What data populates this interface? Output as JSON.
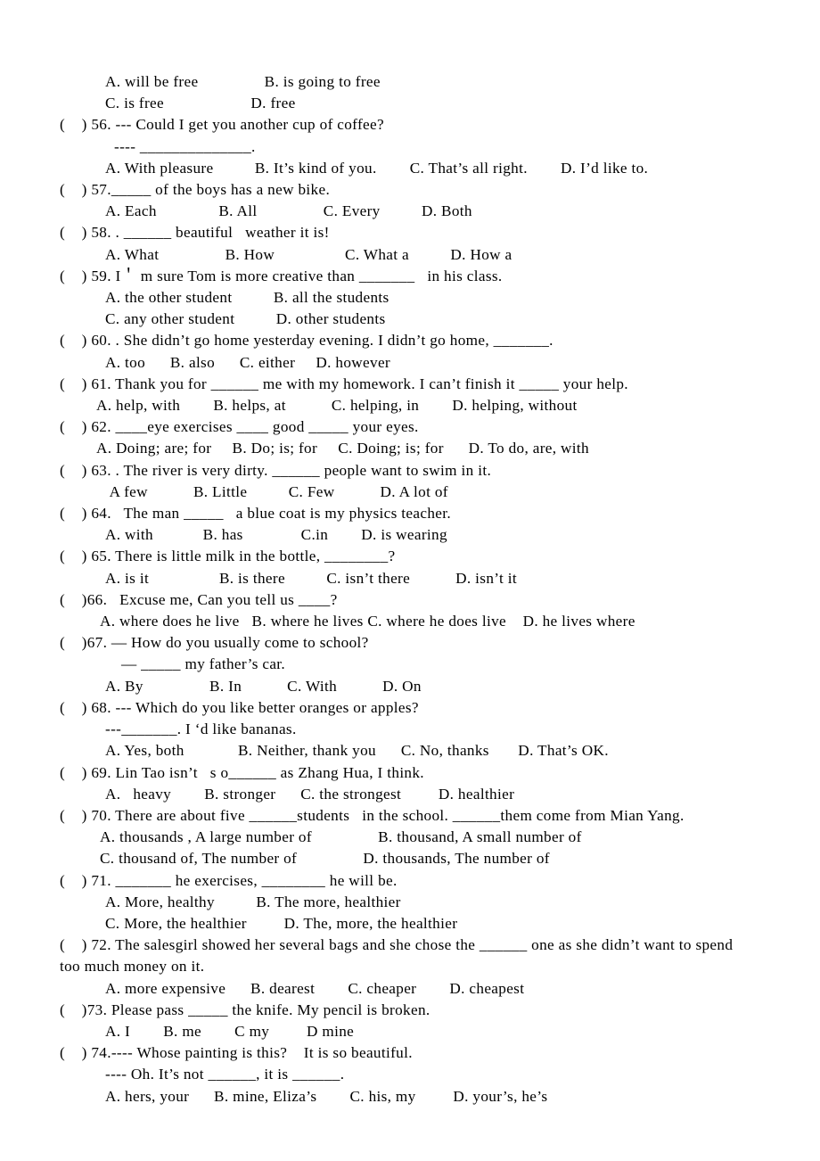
{
  "document": {
    "type": "multiple-choice-grammar-worksheet",
    "page_background": "#ffffff",
    "text_color": "#000000"
  },
  "carryover_options": {
    "row1": "A. will be free                B. is going to free",
    "row2": "C. is free                     D. free"
  },
  "questions": [
    {
      "number": "56",
      "stem": "(    ) 56. --- Could I get you another cup of coffee?",
      "sub": "---- ______________.",
      "option_rows": [
        "A. With pleasure          B. It’s kind of you.        C. That’s all right.        D. I’d like to."
      ]
    },
    {
      "number": "57",
      "stem": "(    ) 57._____ of the boys has a new bike.",
      "option_rows": [
        "A. Each               B. All                C. Every          D. Both"
      ]
    },
    {
      "number": "58",
      "stem": "(    ) 58. . ______ beautiful   weather it is!",
      "option_rows": [
        "A. What                B. How                 C. What a          D. How a"
      ]
    },
    {
      "number": "59",
      "stem": "(    ) 59. I＇ m sure Tom is more creative than _______   in his class.",
      "option_rows": [
        "A. the other student          B. all the students",
        "C. any other student          D. other students"
      ]
    },
    {
      "number": "60",
      "stem": "(    ) 60. . She didn’t go home yesterday evening. I didn’t go home, _______.",
      "option_rows": [
        "A. too      B. also      C. either     D. however"
      ]
    },
    {
      "number": "61",
      "stem": "(    ) 61. Thank you for ______ me with my homework. I can’t finish it _____ your help.",
      "option_rows": [
        "A. help, with        B. helps, at           C. helping, in        D. helping, without"
      ]
    },
    {
      "number": "62",
      "stem": "(    ) 62. ____eye exercises ____ good _____ your eyes.",
      "option_rows": [
        "A. Doing; are; for     B. Do; is; for     C. Doing; is; for      D. To do, are, with"
      ]
    },
    {
      "number": "63",
      "stem": "(    ) 63. . The river is very dirty. ______ people want to swim in it.",
      "option_rows": [
        " A few           B. Little          C. Few           D. A lot of"
      ]
    },
    {
      "number": "64",
      "stem": "(    ) 64.   The man _____   a blue coat is my physics teacher.",
      "option_rows": [
        "A. with            B. has              C.in        D. is wearing"
      ]
    },
    {
      "number": "65",
      "stem": "(    ) 65. There is little milk in the bottle, ________?",
      "option_rows": [
        "A. is it                 B. is there          C. isn’t there           D. isn’t it"
      ]
    },
    {
      "number": "66",
      "stem": "(    )66.   Excuse me, Can you tell us ____?",
      "option_rows": [
        "A. where does he live   B. where he lives C. where he does live    D. he lives where"
      ]
    },
    {
      "number": "67",
      "stem": "(    )67. — How do you usually come to school?",
      "sub": "— _____ my father’s car.",
      "option_rows": [
        "A. By                B. In           C. With           D. On"
      ]
    },
    {
      "number": "68",
      "stem": "(    ) 68. --- Which do you like better oranges or apples?",
      "sub": "---_______. I ‘d like bananas.",
      "option_rows": [
        "A. Yes, both             B. Neither, thank you      C. No, thanks       D. That’s OK."
      ]
    },
    {
      "number": "69",
      "stem": "(    ) 69. Lin Tao isn’t   s o______ as Zhang Hua, I think.",
      "option_rows": [
        "A.   heavy        B. stronger      C. the strongest         D. healthier"
      ]
    },
    {
      "number": "70",
      "stem": "(    ) 70. There are about five ______students   in the school. ______them come from Mian Yang.",
      "option_rows": [
        "A. thousands , A large number of                B. thousand, A small number of",
        "C. thousand of, The number of                D. thousands, The number of"
      ]
    },
    {
      "number": "71",
      "stem": "(    ) 71. _______ he exercises, ________ he will be.",
      "option_rows": [
        "A. More, healthy          B. The more, healthier",
        "C. More, the healthier         D. The, more, the healthier"
      ]
    },
    {
      "number": "72",
      "stem": "(    ) 72. The salesgirl showed her several bags and she chose the ______ one as she didn’t want to spend",
      "stem_wrap": "too much money on it.",
      "option_rows": [
        "A. more expensive      B. dearest        C. cheaper        D. cheapest"
      ]
    },
    {
      "number": "73",
      "stem": "(    )73. Please pass _____ the knife. My pencil is broken.",
      "option_rows": [
        "A. I        B. me        C my         D mine"
      ]
    },
    {
      "number": "74",
      "stem": "(    ) 74.---- Whose painting is this?    It is so beautiful.",
      "sub": "---- Oh. It’s not ______, it is ______.",
      "option_rows": [
        "A. hers, your      B. mine, Eliza’s        C. his, my         D. your’s, he’s"
      ]
    }
  ]
}
